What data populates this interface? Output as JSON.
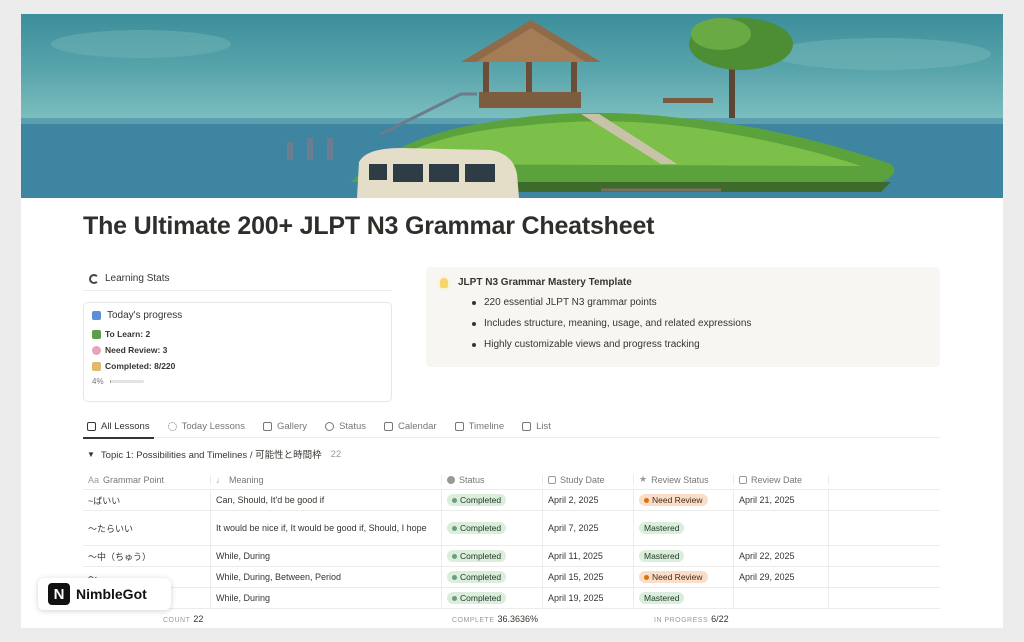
{
  "page": {
    "title": "The Ultimate 200+ JLPT N3 Grammar Cheatsheet"
  },
  "stats": {
    "header": "Learning Stats",
    "card_title": "Today's progress",
    "to_learn": "To Learn: 2",
    "need_review": "Need Review: 3",
    "completed": "Completed: 8/220",
    "percent_label": "4%",
    "percent_value": 4
  },
  "callout": {
    "title": "JLPT N3 Grammar Mastery Template",
    "bullets": [
      "220 essential JLPT N3 grammar points",
      "Includes structure, meaning, usage, and related expressions",
      "Highly customizable views and progress tracking"
    ]
  },
  "tabs": [
    {
      "label": "All Lessons"
    },
    {
      "label": "Today Lessons"
    },
    {
      "label": "Gallery"
    },
    {
      "label": "Status"
    },
    {
      "label": "Calendar"
    },
    {
      "label": "Timeline"
    },
    {
      "label": "List"
    }
  ],
  "group": {
    "label": "Topic 1: Possibilities and Timelines / 可能性と時間枠",
    "count": "22"
  },
  "table": {
    "columns": {
      "aa": "Aa",
      "grammar": "Grammar Point",
      "meaning": "Meaning",
      "status": "Status",
      "study_date": "Study Date",
      "review_status": "Review Status",
      "review_date": "Review Date"
    },
    "rows": [
      {
        "grammar": "~ばいい",
        "meaning": "Can, Should, It'd be good if",
        "status": "Completed",
        "study_date": "April 2, 2025",
        "review": "Need Review",
        "review_date": "April 21, 2025"
      },
      {
        "grammar": "～たらいい",
        "meaning": "It would be nice if, It would be good if, Should, I hope",
        "status": "Completed",
        "study_date": "April 7, 2025",
        "review": "Mastered",
        "review_date": ""
      },
      {
        "grammar": "～中（ちゅう）",
        "meaning": "While, During",
        "status": "Completed",
        "study_date": "April 11, 2025",
        "review": "Mastered",
        "review_date": "April 22, 2025"
      },
      {
        "grammar": "～",
        "meaning": "While, During, Between, Period",
        "status": "Completed",
        "study_date": "April 15, 2025",
        "review": "Need Review",
        "review_date": "April 29, 2025"
      },
      {
        "grammar": "",
        "meaning": "While, During",
        "status": "Completed",
        "study_date": "April 19, 2025",
        "review": "Mastered",
        "review_date": ""
      }
    ]
  },
  "footer": {
    "count_label": "COUNT",
    "count_value": "22",
    "complete_label": "COMPLETE",
    "complete_value": "36.3636%",
    "inprogress_label": "IN PROGRESS",
    "inprogress_value": "6/22"
  },
  "brand": {
    "logo_letter": "N",
    "name": "NimbleGot"
  },
  "colors": {
    "completed_bg": "#dbeddb",
    "review_bg": "#fadec9",
    "review_dot": "#d9730d"
  }
}
